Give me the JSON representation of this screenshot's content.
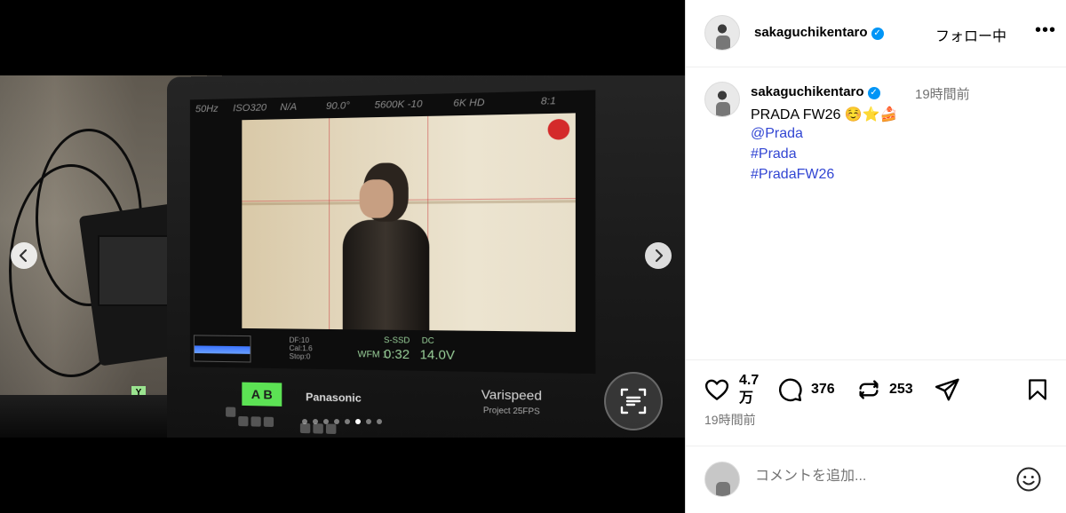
{
  "media": {
    "monitor_osd": [
      "50Hz",
      "ISO320",
      "N/A",
      "90.0°",
      "5600K -10",
      "6K HD",
      "8:1"
    ],
    "hud": {
      "wfm": "WFM 1",
      "s_ssd": "S-SSD",
      "timer": "0:32",
      "dc_label": "DC",
      "voltage": "14.0V",
      "left": "DF:10\nCal:1.6\nStop:0"
    },
    "slate_label": "A B",
    "badge_y": "Y",
    "brand": "Panasonic",
    "varispeed": "Varispeed",
    "project": "Project 25FPS",
    "carousel": {
      "count": 8,
      "active_index": 5
    },
    "prev_icon": "chevron-left-icon",
    "next_icon": "chevron-right-icon",
    "scan_icon": "text-scan-icon"
  },
  "header": {
    "username": "sakaguchikentaro",
    "follow_label": "フォロー中",
    "more_label": "•••"
  },
  "caption": {
    "username": "sakaguchikentaro",
    "time": "19時間前",
    "text": "PRADA  FW26 ☺️⭐🍰",
    "tags": [
      "@Prada",
      "#Prada",
      "#PradaFW26"
    ]
  },
  "actions": {
    "likes": "4.7\n万",
    "likes_line1": "4.7",
    "likes_line2": "万",
    "comments": "376",
    "reposts": "253"
  },
  "time_ago": "19時間前",
  "comment": {
    "placeholder": "コメントを追加..."
  },
  "colors": {
    "link": "#3246d3",
    "verified": "#0095f6",
    "muted": "#737373",
    "rec": "#d42a2a",
    "slate": "#5ce254"
  }
}
